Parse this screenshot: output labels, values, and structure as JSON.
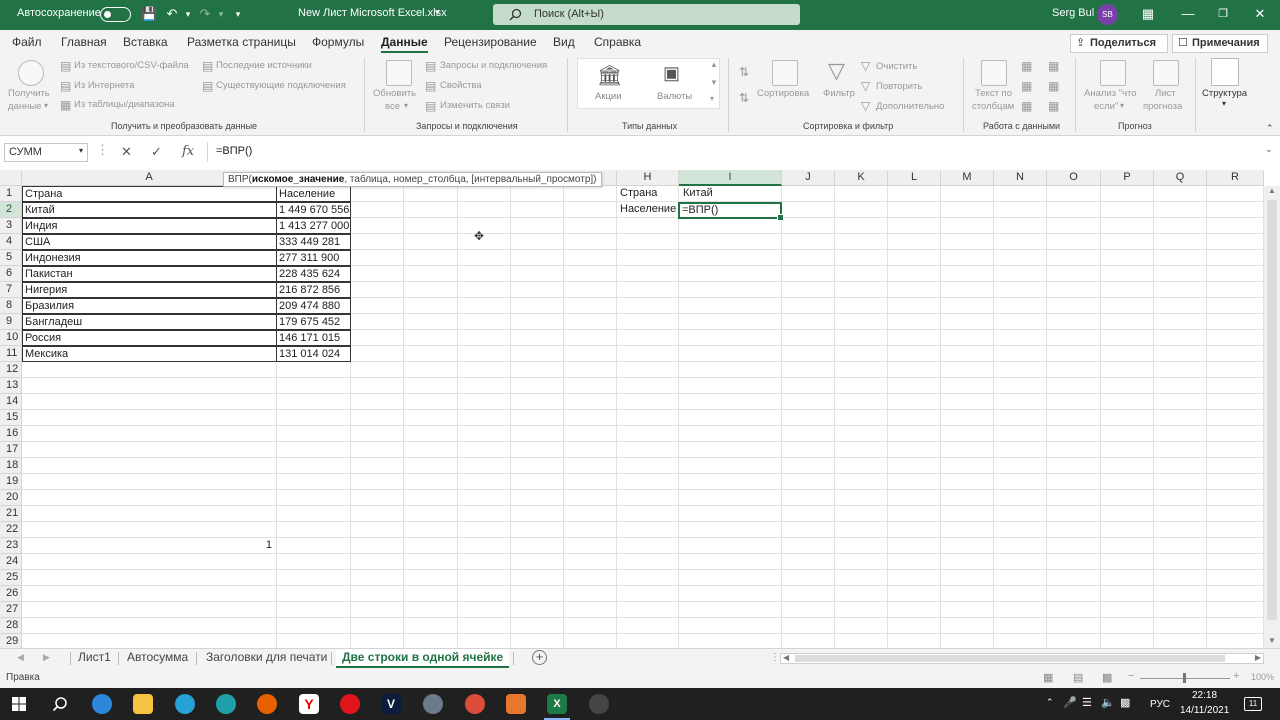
{
  "titlebar": {
    "autosave_label": "Автосохранение",
    "file_title": "New Лист Microsoft Excel.xlsx",
    "search_placeholder": "Поиск (Alt+Ы)",
    "user_name": "Serg Bul",
    "user_initials": "SB"
  },
  "ribbon_tabs": {
    "items": [
      "Файл",
      "Главная",
      "Вставка",
      "Разметка страницы",
      "Формулы",
      "Данные",
      "Рецензирование",
      "Вид",
      "Справка"
    ],
    "active": "Данные",
    "share_label": "Поделиться",
    "comments_label": "Примечания"
  },
  "ribbon": {
    "get_data": {
      "refresh_btn_l1": "Получить",
      "refresh_btn_l2": "данные",
      "from_text": "Из текстового/CSV-файла",
      "from_web": "Из Интернета",
      "from_table": "Из таблицы/диапазона",
      "recent": "Последние источники",
      "existing": "Существующие подключения",
      "group_label": "Получить и преобразовать данные"
    },
    "queries": {
      "refresh_l1": "Обновить",
      "refresh_l2": "все",
      "queries_conn": "Запросы и подключения",
      "properties": "Свойства",
      "edit_links": "Изменить связи",
      "group_label": "Запросы и подключения"
    },
    "data_types": {
      "stocks": "Акции",
      "currencies": "Валюты",
      "group_label": "Типы данных"
    },
    "sort_filter": {
      "sort": "Сортировка",
      "filter": "Фильтр",
      "clear": "Очистить",
      "reapply": "Повторить",
      "advanced": "Дополнительно",
      "group_label": "Сортировка и фильтр"
    },
    "data_tools": {
      "text_to_cols_l1": "Текст по",
      "text_to_cols_l2": "столбцам",
      "group_label": "Работа с данными"
    },
    "forecast": {
      "whatif_l1": "Анализ \"что",
      "whatif_l2": "если\"",
      "sheet_l1": "Лист",
      "sheet_l2": "прогноза",
      "group_label": "Прогноз"
    },
    "outline": {
      "label": "Структура"
    }
  },
  "formula_bar": {
    "name_box": "СУММ",
    "formula": "=ВПР()",
    "fx_label": "fx"
  },
  "tooltip": {
    "func": "ВПР(",
    "arg_bold": "искомое_значение",
    "rest": ", таблица, номер_столбца, [интервальный_просмотр])"
  },
  "grid": {
    "columns": [
      "A",
      "H",
      "I",
      "J",
      "K",
      "L",
      "M",
      "N",
      "O",
      "P",
      "Q",
      "R"
    ],
    "rows": [
      "1",
      "2",
      "3",
      "4",
      "5",
      "6",
      "7",
      "8",
      "9",
      "10",
      "11",
      "12",
      "13",
      "14",
      "15",
      "16",
      "17",
      "18",
      "19",
      "20",
      "21",
      "22",
      "23",
      "24",
      "25",
      "26",
      "27",
      "28",
      "29"
    ],
    "table_header": {
      "country": "Страна",
      "population": "Население"
    },
    "table_rows": [
      {
        "country": "Китай",
        "population": "1 449 670 556"
      },
      {
        "country": "Индия",
        "population": "1 413 277 000"
      },
      {
        "country": "США",
        "population": "333 449 281"
      },
      {
        "country": "Индонезия",
        "population": "277 311 900"
      },
      {
        "country": "Пакистан",
        "population": "228 435 624"
      },
      {
        "country": "Нигерия",
        "population": "216 872 856"
      },
      {
        "country": "Бразилия",
        "population": "209 474 880"
      },
      {
        "country": "Бангладеш",
        "population": "179 675 452"
      },
      {
        "country": "Россия",
        "population": "146 171 015"
      },
      {
        "country": "Мексика",
        "population": "131 014 024"
      }
    ],
    "lookup": {
      "h1": "Страна",
      "i1": "Китай",
      "h2": "Население",
      "i2": "=ВПР()"
    },
    "a23_value": "1"
  },
  "sheets": {
    "tabs": [
      "Лист1",
      "Автосумма",
      "Заголовки для печати",
      "Две строки в одной ячейке"
    ],
    "active": "Две строки в одной ячейке"
  },
  "status": {
    "mode": "Правка",
    "zoom": "100%"
  },
  "taskbar": {
    "lang": "РУС",
    "time": "22:18",
    "date": "14/11/2021"
  }
}
